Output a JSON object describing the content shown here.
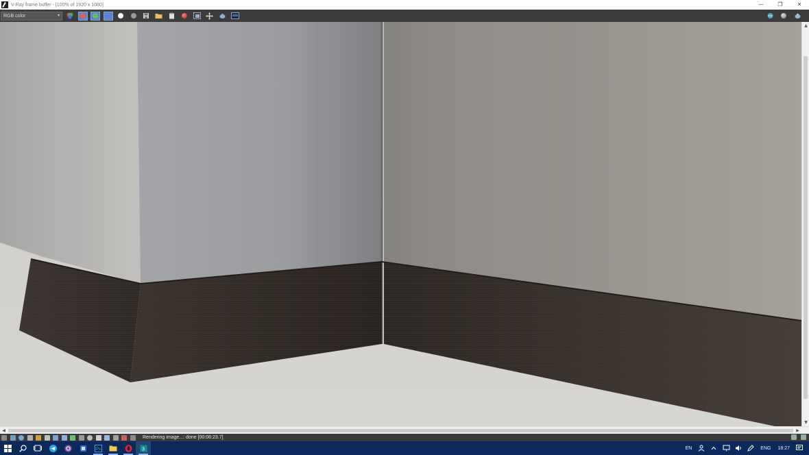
{
  "window": {
    "title": "V-Ray frame buffer - [100% of 1920 x 1080]",
    "minimize": "—",
    "restore": "❐",
    "close": "✕"
  },
  "toolbar": {
    "channel_value": "RGB color",
    "channel_caret": "▾"
  },
  "colors": {
    "toolbar_bg": "#3c3c3c",
    "selected_button": "#5b85c4",
    "taskbar_bg": "#0b2a5b",
    "skirting_wood": "#3a322c",
    "wall_left": "#a6a6a8",
    "wall_right": "#9a9590"
  },
  "statusbar": {
    "message": "Rendering image...: done [00:06:23.7]"
  },
  "taskbar": {
    "apps": [
      "windows-start-icon",
      "search-icon",
      "task-view-icon",
      "telegram-icon",
      "viber-icon",
      "app-blue-icon",
      "photoshop-icon",
      "file-explorer-icon",
      "opera-icon",
      "3dsmax-icon"
    ],
    "lang_short": "EN",
    "lang": "ENG",
    "time": "18:27"
  },
  "scrollbars": {
    "up": "▲",
    "down": "▼",
    "left": "◀",
    "right": "▶"
  }
}
